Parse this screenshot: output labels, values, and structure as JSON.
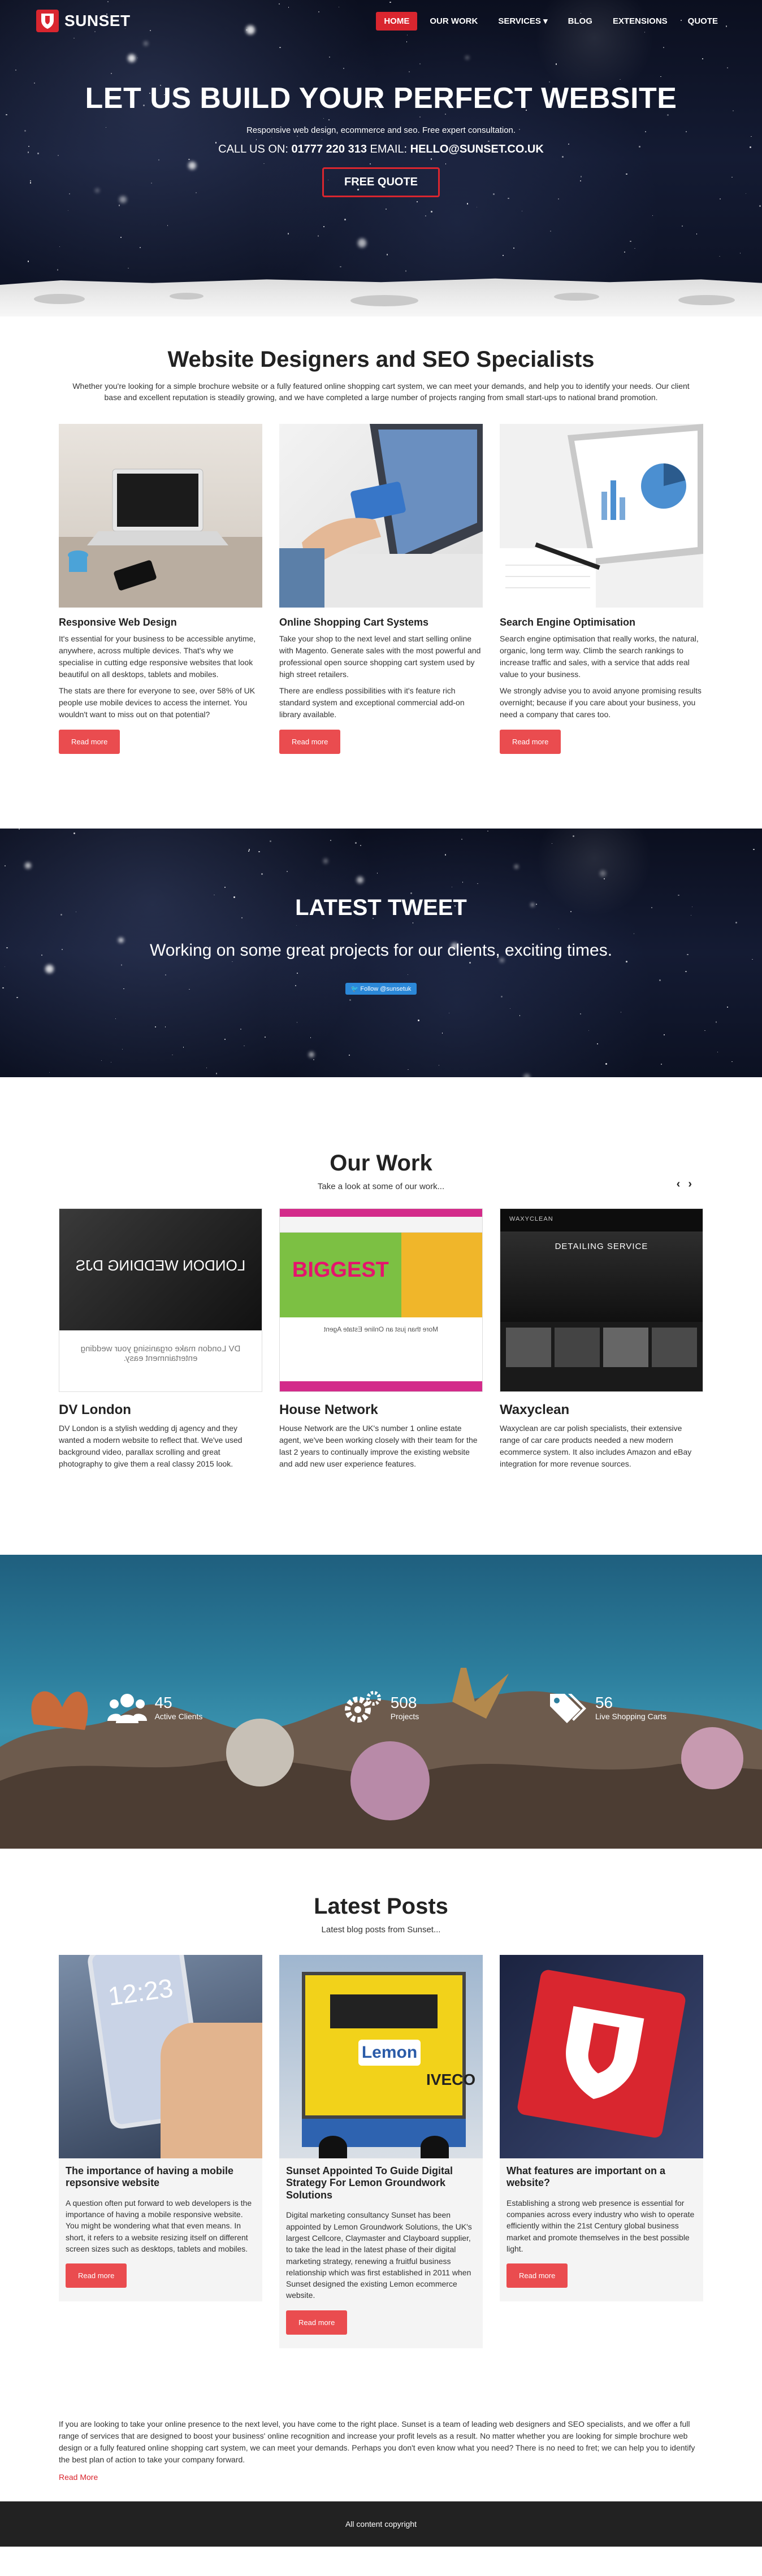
{
  "brand": {
    "name": "SUNSET"
  },
  "nav": {
    "items": [
      {
        "label": "HOME",
        "active": true
      },
      {
        "label": "OUR WORK",
        "active": false
      },
      {
        "label": "SERVICES ▾",
        "active": false
      },
      {
        "label": "BLOG",
        "active": false
      },
      {
        "label": "EXTENSIONS",
        "active": false
      },
      {
        "label": "QUOTE",
        "active": false
      }
    ]
  },
  "hero": {
    "title": "LET US BUILD YOUR PERFECT WEBSITE",
    "subtitle": "Responsive web design, ecommerce and seo. Free expert consultation.",
    "call_prefix": "CALL US ON:",
    "phone": "01777 220 313",
    "email_prefix": "EMAIL:",
    "email": "HELLO@SUNSET.CO.UK",
    "quote_button": "FREE QUOTE"
  },
  "intro": {
    "title": "Website Designers and SEO Specialists",
    "text": "Whether you're looking for a simple brochure website or a fully featured online shopping cart system, we can meet your demands, and help you to identify your needs. Our client base and excellent reputation is steadily growing, and we have completed a large number of projects ranging from small start-ups to national brand promotion."
  },
  "services": [
    {
      "title": "Responsive Web Design",
      "p1": "It's essential for your business to be accessible anytime, anywhere, across multiple devices. That's why we specialise in cutting edge responsive websites that look beautiful on all desktops, tablets and mobiles.",
      "p2": "The stats are there for everyone to see, over 58% of UK people use mobile devices to access the internet. You wouldn't want to miss out on that potential?",
      "button": "Read more"
    },
    {
      "title": "Online Shopping Cart Systems",
      "p1": "Take your shop to the next level and start selling online with Magento. Generate sales with the most powerful and professional open source shopping cart system used by high street retailers.",
      "p2": "There are endless possibilities with it's feature rich standard system and exceptional commercial add-on library available.",
      "button": "Read more"
    },
    {
      "title": "Search Engine Optimisation",
      "p1": "Search engine optimisation that really works, the natural, organic, long term way. Climb the search rankings to increase traffic and sales, with a service that adds real value to your business.",
      "p2": "We strongly advise you to avoid anyone promising results overnight; because if you care about your business, you need a company that cares too.",
      "button": "Read more"
    }
  ],
  "tweet": {
    "title": "LATEST TWEET",
    "text": "Working on some great projects for our clients, exciting times.",
    "follow": "Follow @sunsetuk"
  },
  "work": {
    "title": "Our Work",
    "subtitle": "Take a look at some of our work...",
    "prev": "‹",
    "next": "›",
    "items": [
      {
        "name": "DV London",
        "text": "DV London is a stylish wedding dj agency and they wanted a modern website to reflect that. We've used background video, parallax scrolling and great photography to give them a real classy 2015 look.",
        "shot_title": "LONDON WEDDING DJS",
        "shot_sub": "DV London make organising your wedding entertainment easy."
      },
      {
        "name": "House Network",
        "text": "House Network are the UK's number 1 online estate agent, we've been working closely with their team for the last 2 years to continually improve the existing website and add new user experience features.",
        "shot_title": "BIGGEST",
        "shot_sub": "More than just an Online Estate Agent"
      },
      {
        "name": "Waxyclean",
        "text": "Waxyclean are car polish specialists, their extensive range of car care products needed a new modern ecommerce system. It also includes Amazon and eBay integration for more revenue sources.",
        "shot_title": "DETAILING SERVICE",
        "shot_sub": "WAXYCLEAN"
      }
    ]
  },
  "counters": [
    {
      "number": "45",
      "label": "Active Clients",
      "icon": "users-icon"
    },
    {
      "number": "508",
      "label": "Projects",
      "icon": "gears-icon"
    },
    {
      "number": "56",
      "label": "Live Shopping Carts",
      "icon": "tags-icon"
    }
  ],
  "posts": {
    "title": "Latest Posts",
    "subtitle": "Latest blog posts from Sunset...",
    "items": [
      {
        "title": "The importance of having a mobile repsonsive website",
        "text": "A question often put forward to web developers is the importance of having a mobile responsive website. You might be wondering what that even means. In short, it refers to a website resizing itself on different screen sizes such as desktops, tablets and mobiles.",
        "button": "Read more",
        "phone_time": "12:23"
      },
      {
        "title": "Sunset Appointed To Guide Digital Strategy For Lemon Groundwork Solutions",
        "text": "Digital marketing consultancy Sunset has been appointed by Lemon Groundwork Solutions, the UK's largest Cellcore, Claymaster and Clayboard supplier, to take the lead in the latest phase of their digital marketing strategy, renewing a fruitful business relationship which was first established in 2011 when Sunset designed the existing Lemon ecommerce website.",
        "button": "Read more",
        "truck_brand": "Lemon",
        "truck_make": "IVECO"
      },
      {
        "title": "What features are important on a website?",
        "text": "Establishing a strong web presence is essential for companies across every industry who wish to operate efficiently within the 21st Century global business market and promote themselves in the best possible light.",
        "button": "Read more"
      }
    ]
  },
  "footer": {
    "text": "If you are looking to take your online presence to the next level, you have come to the right place. Sunset is a team of leading web designers and SEO specialists, and we offer a full range of services that are designed to boost your business' online recognition and increase your profit levels as a result. No matter whether you are looking for simple brochure web design or a fully featured online shopping cart system, we can meet your demands. Perhaps you don't even know what you need? There is no need to fret; we can help you to identify the best plan of action to take your company forward.",
    "read_more": "Read More",
    "copyright": "All content copyright"
  },
  "colors": {
    "accent": "#d9262f",
    "button": "#ea4c4f",
    "footer": "#222222"
  }
}
